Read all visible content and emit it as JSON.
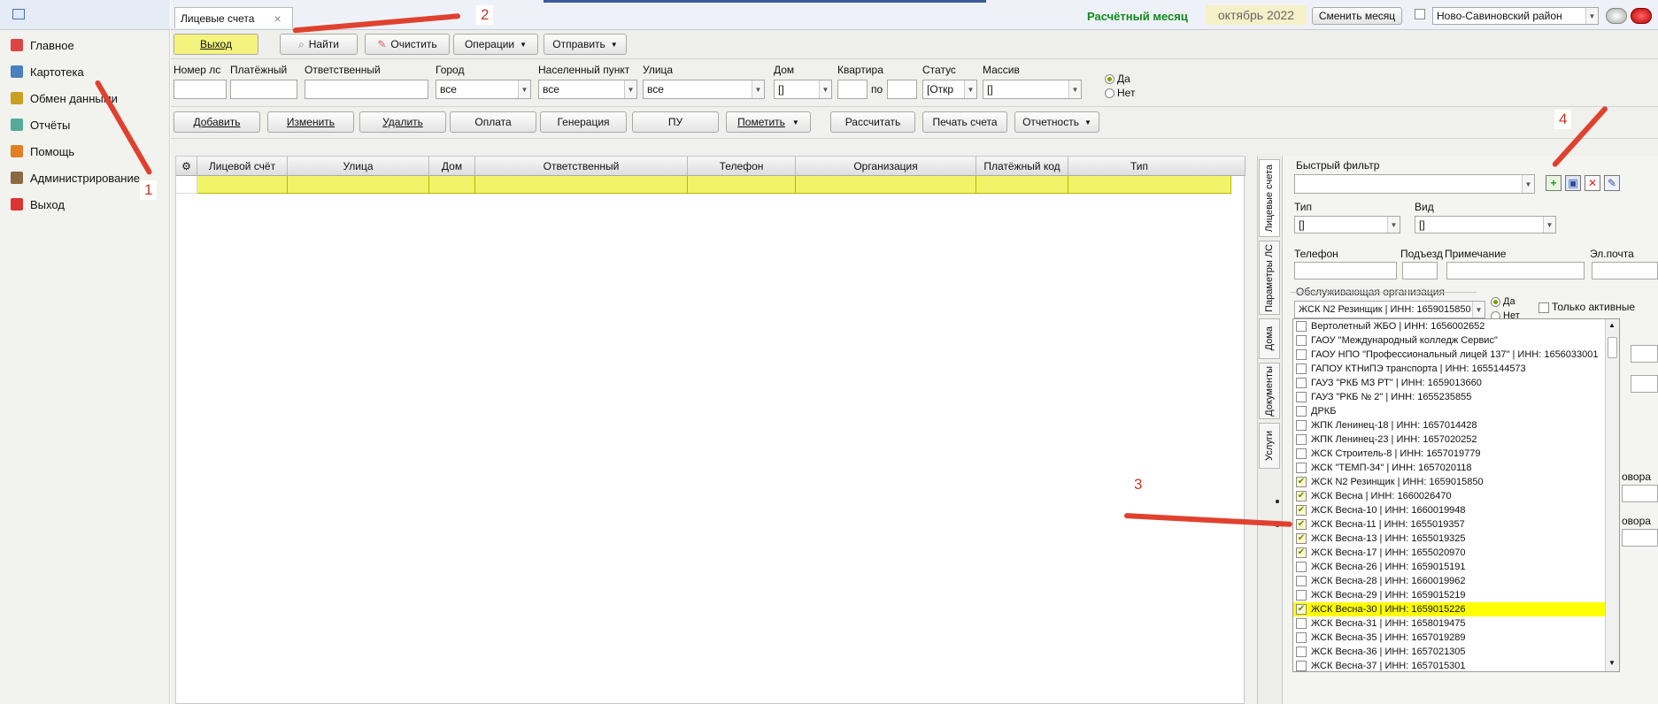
{
  "sidebar": {
    "items": [
      {
        "label": "Главное",
        "color": "#d44"
      },
      {
        "label": "Картотека",
        "color": "#4a7fc0"
      },
      {
        "label": "Обмен данными",
        "color": "#caa020"
      },
      {
        "label": "Отчёты",
        "color": "#5a9"
      },
      {
        "label": "Помощь",
        "color": "#e08020"
      },
      {
        "label": "Администрирование",
        "color": "#8a6a40"
      },
      {
        "label": "Выход",
        "color": "#d33"
      }
    ]
  },
  "tab": {
    "label": "Лицевые счета",
    "close": "×"
  },
  "header": {
    "month_label": "Расчётный месяц",
    "month_value": "октябрь 2022",
    "change_month": "Сменить месяц",
    "district": "Ново-Савиновский район"
  },
  "toolbar1": {
    "exit": "Выход",
    "find": "Найти",
    "clear": "Очистить",
    "operations": "Операции",
    "send": "Отправить"
  },
  "filters": {
    "account_no": "Номер лс",
    "payment": "Платёжный",
    "responsible": "Ответственный",
    "city": "Город",
    "city_value": "все",
    "locality": "Населенный пункт",
    "locality_value": "все",
    "street": "Улица",
    "street_value": "все",
    "house": "Дом",
    "house_value": "[]",
    "apartment": "Квартира",
    "to": "по",
    "status": "Статус",
    "status_value": "[Откр",
    "array": "Массив",
    "array_value": "[]",
    "yes": "Да",
    "no": "Нет"
  },
  "toolbar2": {
    "add": "Добавить",
    "edit": "Изменить",
    "delete": "Удалить",
    "payment": "Оплата",
    "generation": "Генерация",
    "pu": "ПУ",
    "mark": "Пометить",
    "calculate": "Рассчитать",
    "print_invoice": "Печать счета",
    "reports": "Отчетность"
  },
  "grid": {
    "columns": [
      "Лицевой счёт",
      "Улица",
      "Дом",
      "Ответственный",
      "Телефон",
      "Организация",
      "Платёжный код",
      "Тип"
    ]
  },
  "vtabs": [
    "Лицевые счета",
    "Параметры ЛС",
    "Дома",
    "Документы",
    "Услуги"
  ],
  "panel": {
    "quick_filter": "Быстрый фильтр",
    "type": "Тип",
    "type_value": "[]",
    "kind": "Вид",
    "kind_value": "[]",
    "phone": "Телефон",
    "entrance": "Подъезд",
    "note": "Примечание",
    "email": "Эл.почта",
    "service_org": "Обслуживающая организация",
    "service_org_value": "ЖСК N2 Резинщик | ИНН: 1659015850",
    "yes": "Да",
    "no": "Нет",
    "only_active": "Только активные",
    "contract1": "овора",
    "contract2": "овора"
  },
  "org_list": [
    {
      "t": "Вертолетный ЖБО | ИНН: 1656002652",
      "c": false
    },
    {
      "t": "ГАОУ \"Международный колледж Сервис\"",
      "c": false
    },
    {
      "t": "ГАОУ НПО \"Профессиональный лицей 137\" | ИНН: 1656033001",
      "c": false
    },
    {
      "t": "ГАПОУ КТНиПЭ транспорта | ИНН: 1655144573",
      "c": false
    },
    {
      "t": "ГАУЗ \"РКБ МЗ РТ\" | ИНН: 1659013660",
      "c": false
    },
    {
      "t": "ГАУЗ \"РКБ № 2\" | ИНН: 1655235855",
      "c": false
    },
    {
      "t": "ДРКБ",
      "c": false
    },
    {
      "t": "ЖПК Ленинец-18 | ИНН: 1657014428",
      "c": false
    },
    {
      "t": "ЖПК Ленинец-23 | ИНН: 1657020252",
      "c": false
    },
    {
      "t": "ЖСК  Строитель-8 | ИНН: 1657019779",
      "c": false
    },
    {
      "t": "ЖСК \"ТЕМП-34\" | ИНН: 1657020118",
      "c": false
    },
    {
      "t": "ЖСК N2 Резинщик | ИНН: 1659015850",
      "c": true
    },
    {
      "t": "ЖСК Весна | ИНН: 1660026470",
      "c": true
    },
    {
      "t": "ЖСК Весна-10 | ИНН: 1660019948",
      "c": true
    },
    {
      "t": "ЖСК Весна-11 | ИНН: 1655019357",
      "c": true
    },
    {
      "t": "ЖСК Весна-13 | ИНН: 1655019325",
      "c": true
    },
    {
      "t": "ЖСК Весна-17 | ИНН: 1655020970",
      "c": true
    },
    {
      "t": "ЖСК Весна-26 | ИНН: 1659015191",
      "c": false
    },
    {
      "t": "ЖСК Весна-28 | ИНН: 1660019962",
      "c": false
    },
    {
      "t": "ЖСК Весна-29 | ИНН: 1659015219",
      "c": false
    },
    {
      "t": "ЖСК Весна-30 | ИНН: 1659015226",
      "c": true,
      "hl": true
    },
    {
      "t": "ЖСК Весна-31 | ИНН: 1658019475",
      "c": false
    },
    {
      "t": "ЖСК Весна-35 | ИНН: 1657019289",
      "c": false
    },
    {
      "t": "ЖСК Весна-36 | ИНН: 1657021305",
      "c": false
    },
    {
      "t": "ЖСК Весна-37 | ИНН: 1657015301",
      "c": false
    }
  ],
  "annotations": [
    "1",
    "2",
    "3",
    "4"
  ]
}
